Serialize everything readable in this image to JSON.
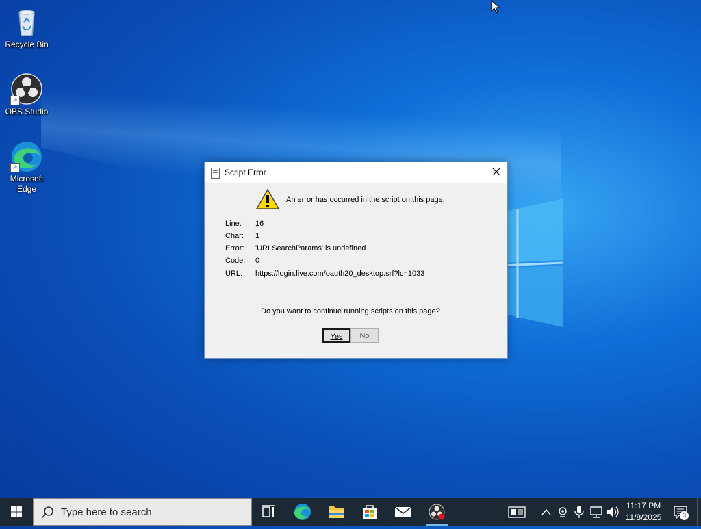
{
  "desktop": {
    "icons": [
      {
        "label": "Recycle Bin"
      },
      {
        "label": "OBS Studio"
      },
      {
        "label": "Microsoft Edge"
      }
    ]
  },
  "dialog": {
    "title": "Script Error",
    "message": "An error has occurred in the script on this page.",
    "details": [
      {
        "key": "Line:",
        "value": "16"
      },
      {
        "key": "Char:",
        "value": "1"
      },
      {
        "key": "Error:",
        "value": "'URLSearchParams' is undefined"
      },
      {
        "key": "Code:",
        "value": "0"
      },
      {
        "key": "URL:",
        "value": "https://login.live.com/oauth20_desktop.srf?lc=1033"
      }
    ],
    "question": "Do you want to continue running scripts on this page?",
    "yes_label": "Yes",
    "no_label": "No"
  },
  "taskbar": {
    "search_placeholder": "Type here to search",
    "apps": [
      "task-view",
      "edge",
      "file-explorer",
      "store",
      "mail",
      "obs-studio"
    ],
    "clock_time": "11:17 PM",
    "clock_date": "11/8/2025",
    "notification_count": "3"
  },
  "colors": {
    "taskbar": "#1c2834",
    "accent": "#0a6fd8",
    "dialog_bg": "#f0f0f0"
  }
}
